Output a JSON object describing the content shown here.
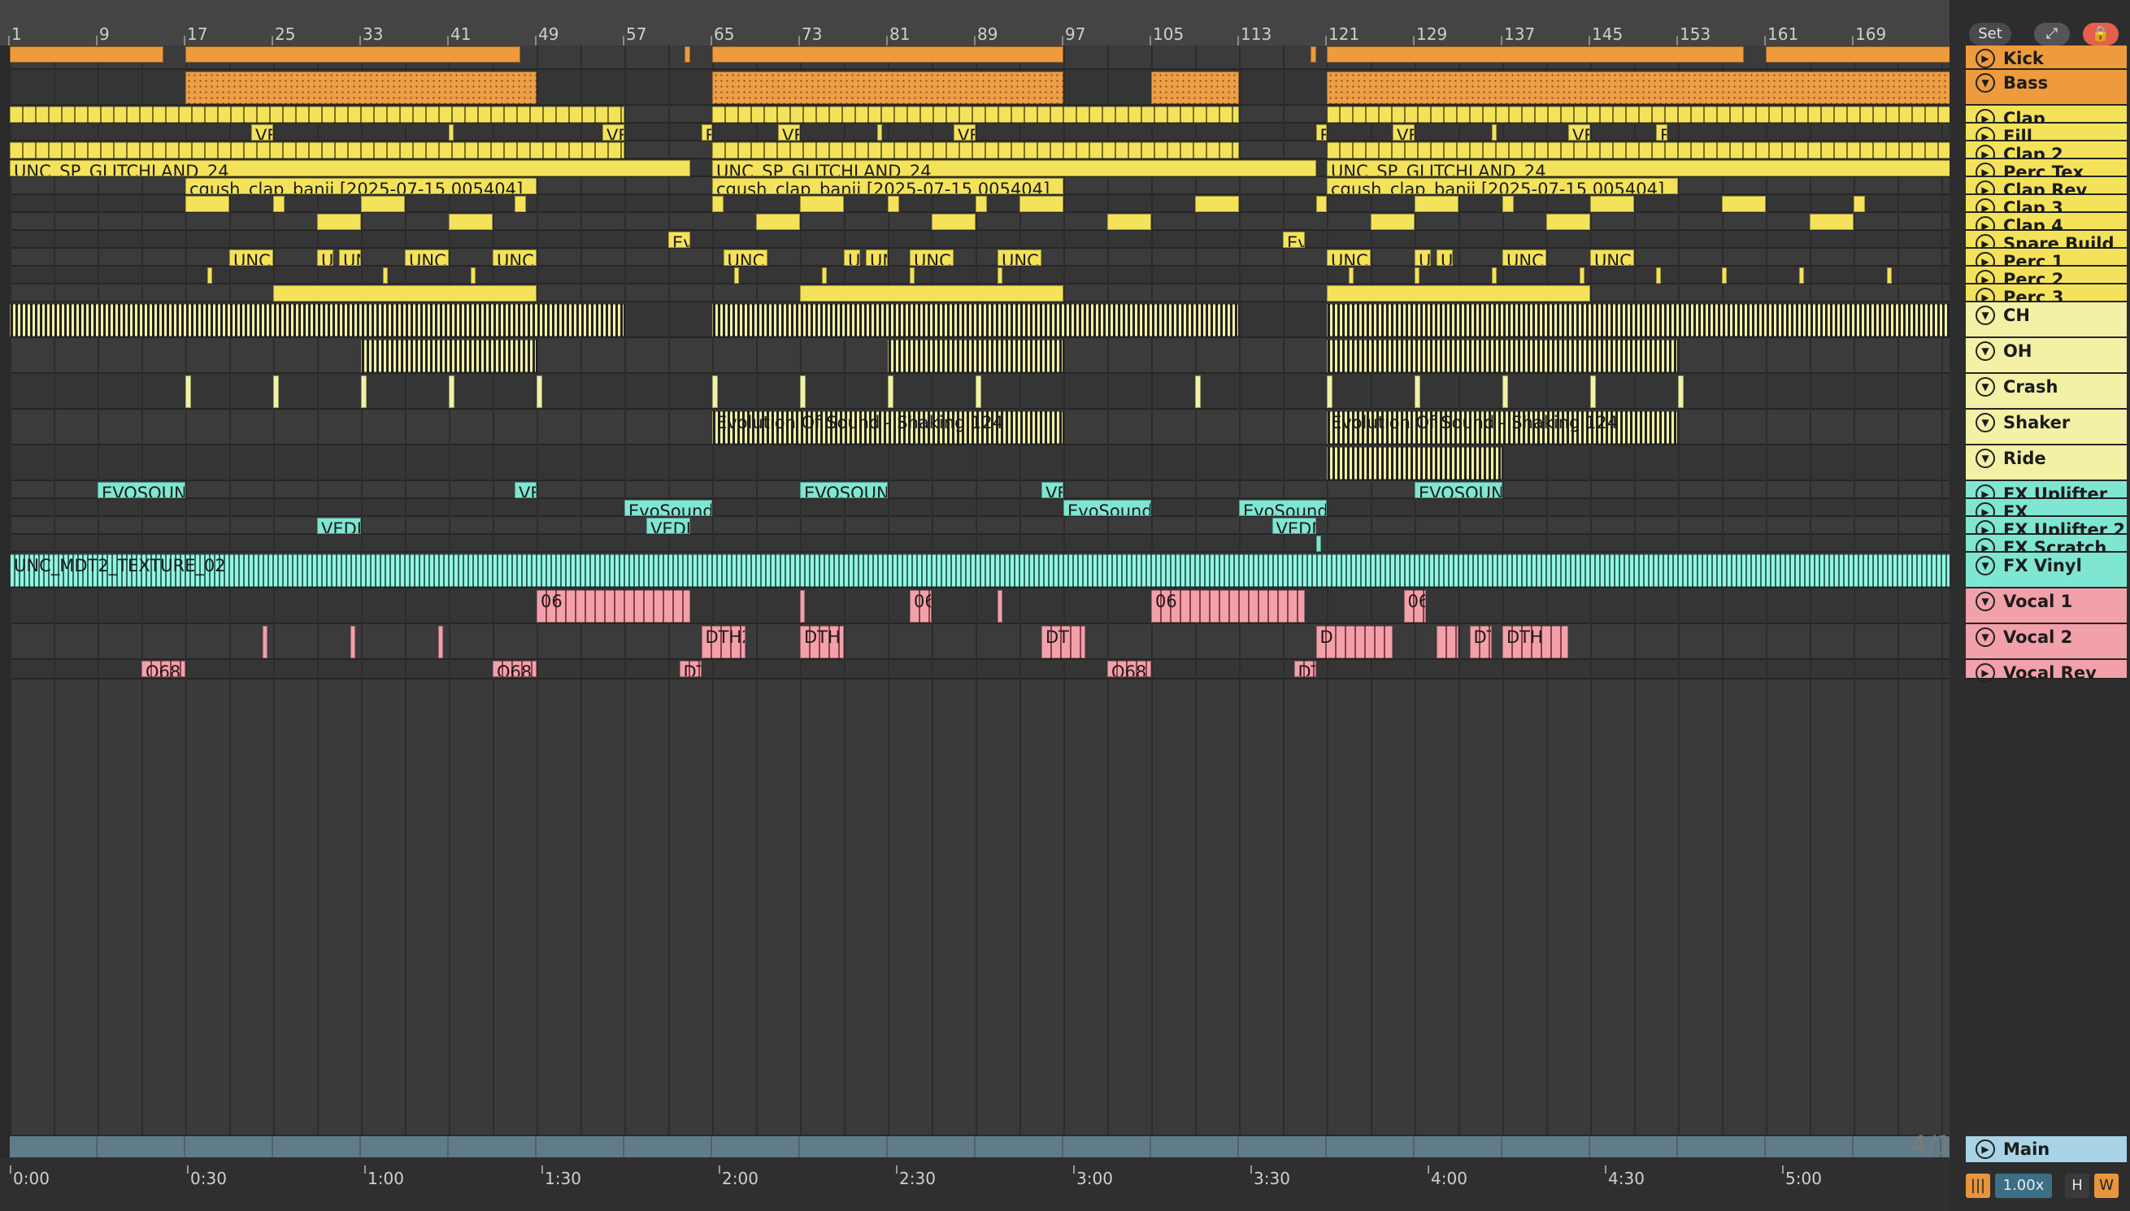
{
  "ruler": {
    "bars": [
      "1",
      "9",
      "17",
      "25",
      "33",
      "41",
      "49",
      "57",
      "65",
      "73",
      "81",
      "89",
      "97",
      "105",
      "113",
      "121",
      "129",
      "137",
      "145",
      "153",
      "161",
      "169"
    ]
  },
  "timeline": {
    "marks": [
      "0:00",
      "0:30",
      "1:00",
      "1:30",
      "2:00",
      "2:30",
      "3:00",
      "3:30",
      "4:00",
      "4:30",
      "5:00"
    ]
  },
  "toolbar": {
    "set_label": "Set",
    "zoom": "1.00x",
    "h_label": "H",
    "w_label": "W",
    "time_sig": "4/1"
  },
  "tracks": [
    {
      "name": "Kick",
      "color": "#ed9b3c",
      "state": "collapsed"
    },
    {
      "name": "Bass",
      "color": "#ed9b3c",
      "state": "expanded"
    },
    {
      "name": "Clap",
      "color": "#f4e35a",
      "state": "collapsed"
    },
    {
      "name": "Fill",
      "color": "#f4e35a",
      "state": "collapsed"
    },
    {
      "name": "Clap 2",
      "color": "#f4e35a",
      "state": "collapsed"
    },
    {
      "name": "Perc Tex",
      "color": "#f4e35a",
      "state": "collapsed"
    },
    {
      "name": "Clap Rev",
      "color": "#f4e35a",
      "state": "collapsed"
    },
    {
      "name": "Clap 3",
      "color": "#f4e35a",
      "state": "collapsed"
    },
    {
      "name": "Clap 4",
      "color": "#f4e35a",
      "state": "collapsed"
    },
    {
      "name": "Snare Build",
      "color": "#f4e35a",
      "state": "collapsed"
    },
    {
      "name": "Perc 1",
      "color": "#f4e35a",
      "state": "collapsed"
    },
    {
      "name": "Perc 2",
      "color": "#f4e35a",
      "state": "collapsed"
    },
    {
      "name": "Perc 3",
      "color": "#f4e35a",
      "state": "collapsed"
    },
    {
      "name": "CH",
      "color": "#f2f1a6",
      "state": "expanded"
    },
    {
      "name": "OH",
      "color": "#f2f1a6",
      "state": "expanded"
    },
    {
      "name": "Crash",
      "color": "#f2f1a6",
      "state": "expanded"
    },
    {
      "name": "Shaker",
      "color": "#f2f1a6",
      "state": "expanded"
    },
    {
      "name": "Ride",
      "color": "#f2f1a6",
      "state": "expanded"
    },
    {
      "name": "FX Uplifter",
      "color": "#7fe6d2",
      "state": "collapsed"
    },
    {
      "name": "FX Downlifter",
      "color": "#7fe6d2",
      "state": "collapsed"
    },
    {
      "name": "FX Uplifter 2",
      "color": "#7fe6d2",
      "state": "collapsed"
    },
    {
      "name": "FX Scratch",
      "color": "#7fe6d2",
      "state": "collapsed"
    },
    {
      "name": "FX Vinyl",
      "color": "#7fe6d2",
      "state": "expanded"
    },
    {
      "name": "Vocal 1",
      "color": "#f2a0aa",
      "state": "expanded"
    },
    {
      "name": "Vocal 2",
      "color": "#f2a0aa",
      "state": "expanded"
    },
    {
      "name": "Vocal Rev",
      "color": "#f2a0aa",
      "state": "collapsed"
    }
  ],
  "main_track": {
    "name": "Main"
  },
  "clip_labels": {
    "glitch": "UNC_SP_GLITCHLAND_24",
    "cgush": "cgush_clap_banji [2025-07-15 005404]",
    "evolution": "Evolution Of Sound - Shaking 124",
    "texture": "UNC_MDT2_TEXTURE_02",
    "ve": "VE",
    "e": "E",
    "unc": "UNC",
    "u": "U",
    "un": "UN",
    "ev": "Ev",
    "evosound": "EVOSOUND",
    "evosounds": "EvoSounds",
    "vedm": "VEDM",
    "vedm_short": "VEDN",
    "v06": "06",
    "dth2": "DTH2",
    "dth": "DTH",
    "dt": "DT",
    "d": "D",
    "o68": "O68"
  }
}
